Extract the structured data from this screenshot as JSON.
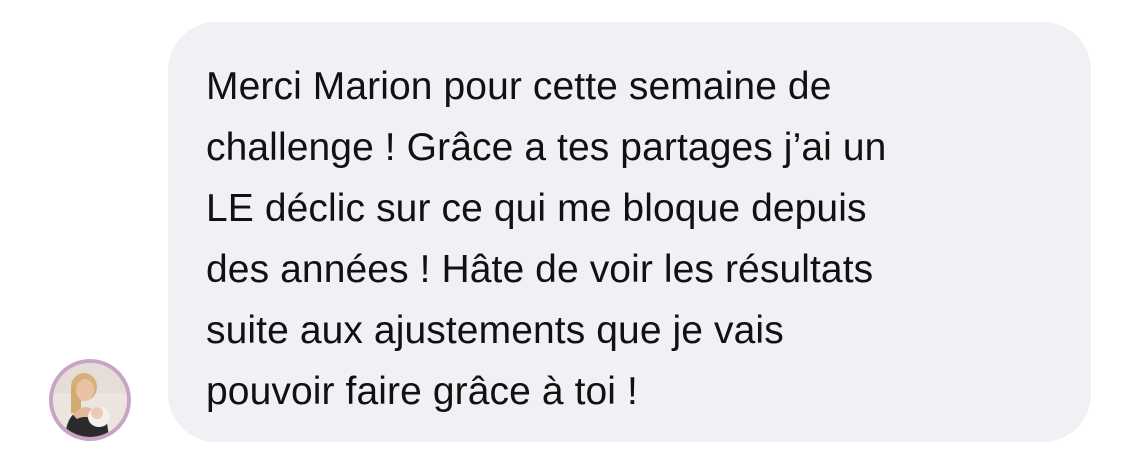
{
  "message": {
    "text": "Merci Marion pour cette semaine de\nchallenge ! Grâce a tes partages j’ai un\nLE déclic sur ce qui me bloque depuis\ndes années ! Hâte de voir les résultats\nsuite aux ajustements que je vais\npouvoir faire grâce à toi !"
  },
  "colors": {
    "bubble_background": "#f0f1f5",
    "text": "#111111",
    "avatar_ring": "#c9a4c6"
  }
}
